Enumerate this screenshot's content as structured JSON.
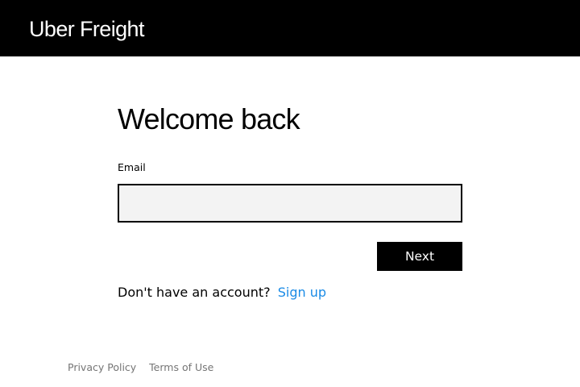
{
  "header": {
    "logo_text": "Uber Freight",
    "background": "#000000"
  },
  "login": {
    "title": "Welcome back",
    "email_label": "Email",
    "email_value": "",
    "email_placeholder": "",
    "next_label": "Next",
    "no_account_text": "Don't have an account?",
    "signup_label": "Sign up",
    "link_color": "#1a8be6"
  },
  "footer": {
    "privacy_label": "Privacy Policy",
    "terms_label": "Terms of Use"
  }
}
